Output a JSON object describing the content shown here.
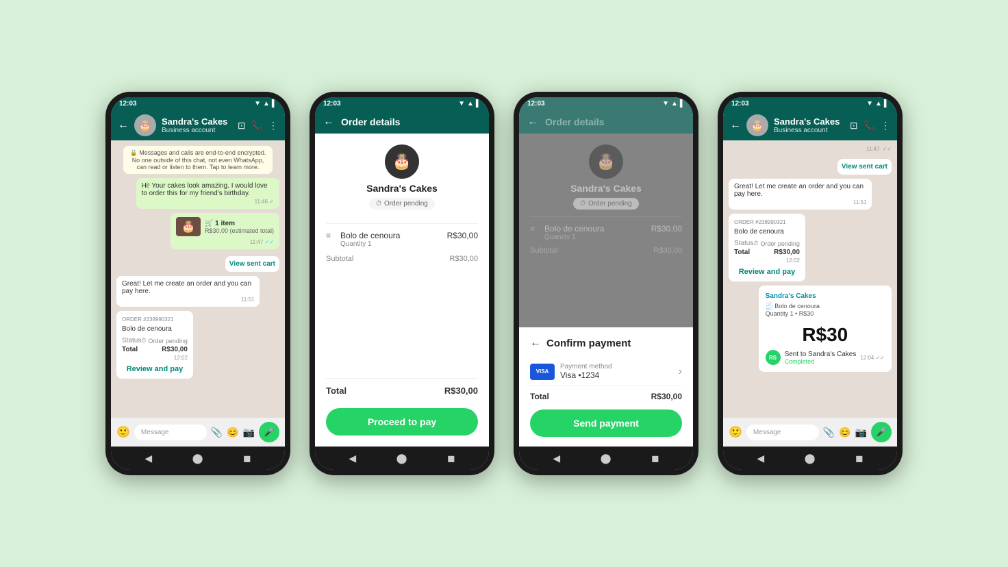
{
  "page": {
    "bg": "#d8f0d8"
  },
  "phone1": {
    "status_time": "12:03",
    "header_name": "Sandra's Cakes",
    "header_sub": "Business account",
    "system_msg": "🔒 Messages and calls are end-to-end encrypted. No one outside of this chat, not even WhatsApp, can read or listen to them. Tap to learn more.",
    "msg1": "Hi! Your cakes look amazing. I would love to order this for my friend's birthday.",
    "msg1_time": "11:46",
    "cart_count": "🛒 1 item",
    "cart_price": "R$30,00 (estimated total)",
    "cart_time": "11:47",
    "view_cart": "View sent cart",
    "msg2": "Great! Let me create an order and you can pay here.",
    "msg2_time": "11:51",
    "order_number": "ORDER #238990321",
    "order_product": "Bolo de cenoura",
    "status_label": "Status",
    "status_value": "Order pending",
    "total_label": "Total",
    "total_value": "R$30,00",
    "order_time": "12:02",
    "review_link": "Review and pay",
    "input_placeholder": "Message",
    "mic_icon": "🎤"
  },
  "phone2": {
    "status_time": "12:03",
    "header_title": "Order details",
    "seller_name": "Sandra's Cakes",
    "order_status": "Order pending",
    "item_name": "Bolo de cenoura",
    "item_qty": "Quantity 1",
    "item_price": "R$30,00",
    "subtotal_label": "Subtotal",
    "subtotal_value": "R$30,00",
    "total_label": "Total",
    "total_value": "R$30,00",
    "proceed_btn": "Proceed to pay"
  },
  "phone3": {
    "status_time": "12:03",
    "header_title": "Order details",
    "seller_name": "Sandra's Cakes",
    "order_status": "Order pending",
    "item_name": "Bolo de cenoura",
    "item_qty": "Quantity 1",
    "item_price": "R$30,00",
    "subtotal_label": "Subtotal",
    "subtotal_value": "R$30,00",
    "confirm_title": "Confirm payment",
    "payment_method_label": "Payment method",
    "payment_method_value": "Visa •1234",
    "total_label": "Total",
    "total_value": "R$30,00",
    "send_btn": "Send payment"
  },
  "phone4": {
    "status_time": "12:03",
    "header_name": "Sandra's Cakes",
    "header_sub": "Business account",
    "view_cart": "View sent cart",
    "cart_time": "11:47",
    "msg1": "Great! Let me create an order and you can pay here.",
    "msg1_time": "11:51",
    "order_number": "ORDER #238990321",
    "order_product": "Bolo de cenoura",
    "status_label": "Status",
    "status_value": "Order pending",
    "total_label": "Total",
    "total_value": "R$30,00",
    "order_time": "12:02",
    "review_link": "Review and pay",
    "payment_card_brand": "Sandra's Cakes",
    "payment_card_item": "🧾 Bolo de cenoura",
    "payment_card_qty": "Quantity 1 • R$30",
    "payment_amount": "R$30",
    "sent_to": "Sent to Sandra's Cakes",
    "completed": "Completed",
    "sent_time": "12:04",
    "input_placeholder": "Message",
    "mic_icon": "🎤"
  }
}
